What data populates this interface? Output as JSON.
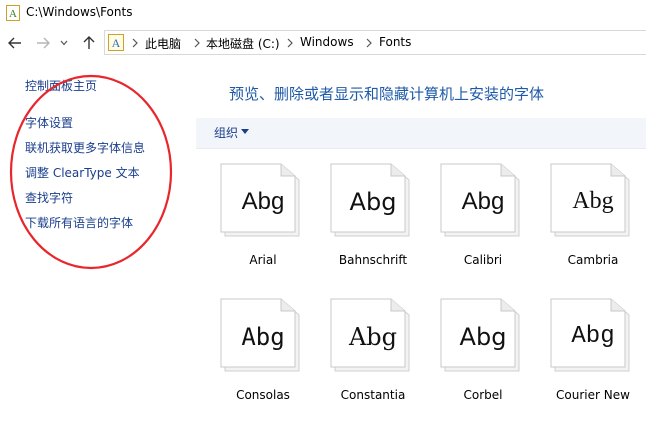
{
  "window": {
    "title": "C:\\Windows\\Fonts"
  },
  "nav": {
    "back_icon": "arrow-left-icon",
    "forward_icon": "arrow-right-icon",
    "recent_icon": "chevron-down-icon",
    "up_icon": "arrow-up-icon"
  },
  "address": {
    "crumbs": [
      "此电脑",
      "本地磁盘 (C:)",
      "Windows",
      "Fonts"
    ]
  },
  "sidebar": {
    "items": [
      {
        "label": "控制面板主页"
      },
      {
        "label": "字体设置"
      },
      {
        "label": "联机获取更多字体信息"
      },
      {
        "label": "调整 ClearType 文本"
      },
      {
        "label": "查找字符"
      },
      {
        "label": "下载所有语言的字体"
      }
    ],
    "annotation_color": "#e8262b"
  },
  "main": {
    "title": "预览、删除或者显示和隐藏计算机上安装的字体",
    "title_color": "#1e5aa8"
  },
  "toolbar": {
    "organize_label": "组织"
  },
  "fonts": [
    {
      "name": "Arial",
      "sample": "Abg",
      "family": "Liberation Sans, sans-serif"
    },
    {
      "name": "Bahnschrift",
      "sample": "Abg",
      "family": "DejaVu Sans, sans-serif"
    },
    {
      "name": "Calibri",
      "sample": "Abg",
      "family": "Liberation Sans, sans-serif"
    },
    {
      "name": "Cambria",
      "sample": "Abg",
      "family": "Liberation Serif, serif"
    },
    {
      "name": "Consolas",
      "sample": "Abg",
      "family": "DejaVu Sans Mono, monospace"
    },
    {
      "name": "Constantia",
      "sample": "Abg",
      "family": "DejaVu Serif, serif"
    },
    {
      "name": "Corbel",
      "sample": "Abg",
      "family": "DejaVu Sans, sans-serif"
    },
    {
      "name": "Courier New",
      "sample": "Abg",
      "family": "Liberation Mono, monospace"
    }
  ]
}
